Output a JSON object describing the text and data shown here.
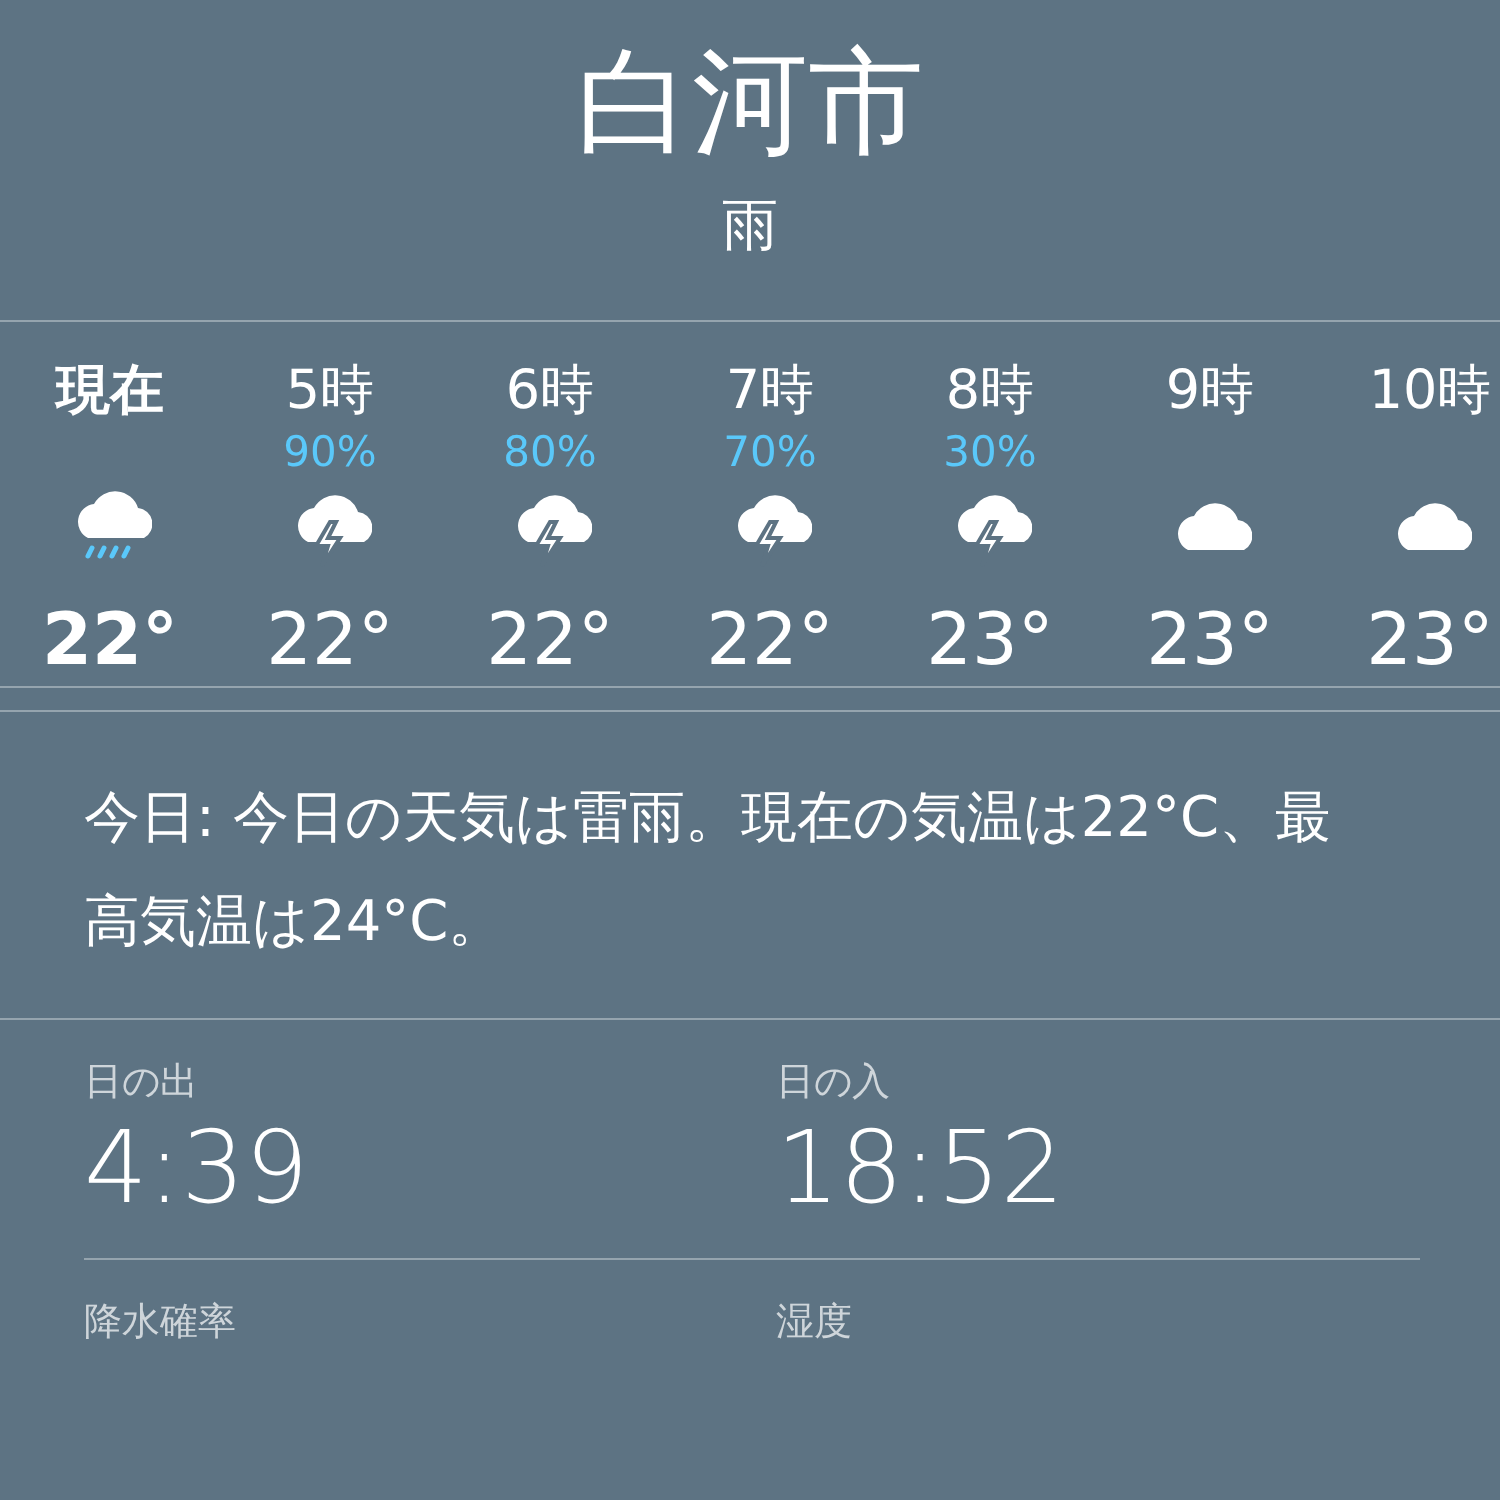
{
  "city": "白河市",
  "condition": "雨",
  "hourly": [
    {
      "time": "現在",
      "current": true,
      "kind": "rain",
      "temp": "22°"
    },
    {
      "time": "5時",
      "current": false,
      "chance": "90%",
      "kind": "thunder",
      "temp": "22°"
    },
    {
      "time": "6時",
      "current": false,
      "chance": "80%",
      "kind": "thunder",
      "temp": "22°"
    },
    {
      "time": "7時",
      "current": false,
      "chance": "70%",
      "kind": "thunder",
      "temp": "22°"
    },
    {
      "time": "8時",
      "current": false,
      "chance": "30%",
      "kind": "thunder",
      "temp": "23°"
    },
    {
      "time": "9時",
      "current": false,
      "kind": "cloud",
      "temp": "23°"
    },
    {
      "time": "10時",
      "current": false,
      "kind": "cloud",
      "temp": "23°"
    }
  ],
  "summary": "今日: 今日の天気は雷雨。現在の気温は22°C、最高気温は24°C。",
  "details": [
    {
      "label": "日の出",
      "value": "4:39"
    },
    {
      "label": "日の入",
      "value": "18:52"
    },
    {
      "label": "降水確率"
    },
    {
      "label": "湿度"
    }
  ]
}
